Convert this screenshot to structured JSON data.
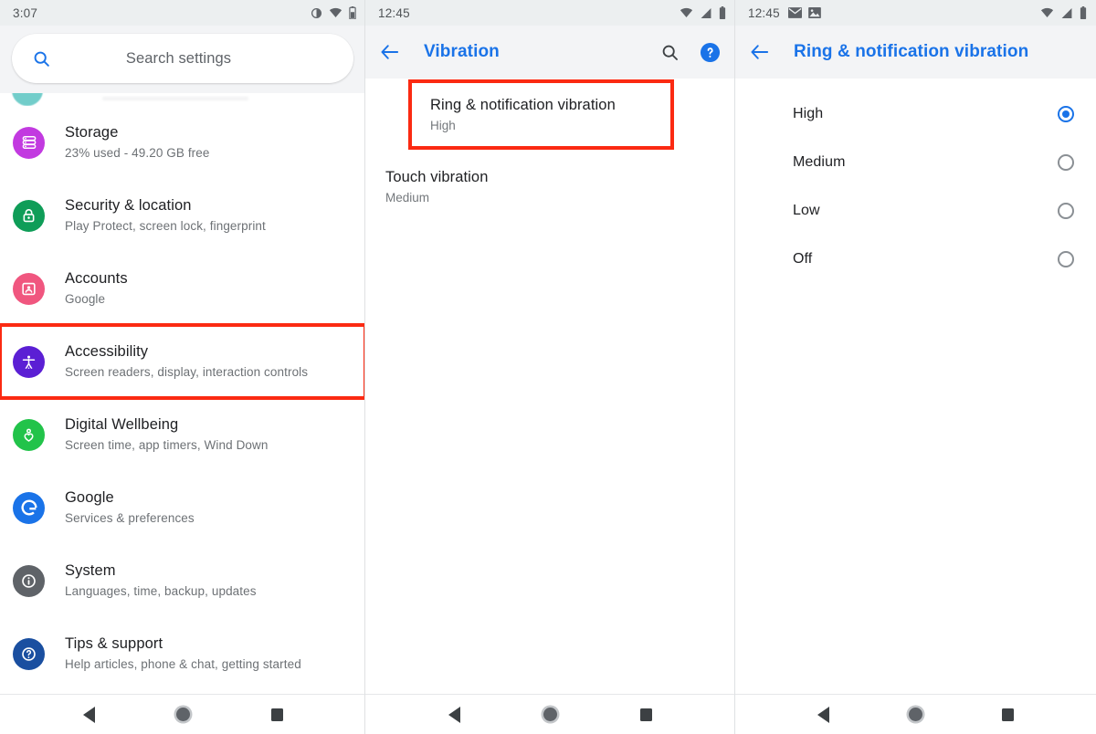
{
  "colors": {
    "accent_blue": "#1a73e8",
    "highlight_red": "#fb2a12",
    "statusbar_bg": "#eceff0",
    "appbar_bg": "#f3f4f6",
    "text_primary": "#202124",
    "text_secondary": "#6d7175"
  },
  "left_panel": {
    "statusbar": {
      "clock": "3:07",
      "icons": [
        "brightness-contrast-icon",
        "wifi-icon",
        "battery-icon"
      ]
    },
    "search": {
      "icon": "search-icon",
      "placeholder": "Search settings",
      "value": ""
    },
    "items": [
      {
        "title": "Storage",
        "subtitle": "23% used - 49.20 GB free",
        "icon": "storage-icon",
        "color": "#c23ae0",
        "highlighted": false
      },
      {
        "title": "Security & location",
        "subtitle": "Play Protect, screen lock, fingerprint",
        "icon": "lock-icon",
        "color": "#0f9d58",
        "highlighted": false
      },
      {
        "title": "Accounts",
        "subtitle": "Google",
        "icon": "account-badge-icon",
        "color": "#f0567f",
        "highlighted": false
      },
      {
        "title": "Accessibility",
        "subtitle": "Screen readers, display, interaction controls",
        "icon": "accessibility-person-icon",
        "color": "#5b1fd4",
        "highlighted": true
      },
      {
        "title": "Digital Wellbeing",
        "subtitle": "Screen time, app timers, Wind Down",
        "icon": "heart-person-icon",
        "color": "#22c34a",
        "highlighted": false
      },
      {
        "title": "Google",
        "subtitle": "Services & preferences",
        "icon": "google-g-icon",
        "color": "#1a73e8",
        "highlighted": false
      },
      {
        "title": "System",
        "subtitle": "Languages, time, backup, updates",
        "icon": "info-circle-icon",
        "color": "#5f6368",
        "highlighted": false
      },
      {
        "title": "Tips & support",
        "subtitle": "Help articles, phone & chat, getting started",
        "icon": "question-circle-icon",
        "color": "#1a4fa0",
        "highlighted": false
      }
    ],
    "navbar": {
      "back": "back-triangle-icon",
      "home": "home-circle-icon",
      "recents": "recents-square-icon"
    }
  },
  "mid_panel": {
    "statusbar": {
      "clock": "12:45",
      "icons": [
        "wifi-icon",
        "signal-icon",
        "battery-icon"
      ]
    },
    "appbar": {
      "back_icon": "back-arrow-icon",
      "title": "Vibration",
      "search_icon": "search-icon",
      "help_icon": "help-circle-icon"
    },
    "items": [
      {
        "title": "Ring & notification vibration",
        "value": "High",
        "highlighted": true
      },
      {
        "title": "Touch vibration",
        "value": "Medium",
        "highlighted": false
      }
    ],
    "navbar": {
      "back": "back-triangle-icon",
      "home": "home-circle-icon",
      "recents": "recents-square-icon"
    }
  },
  "right_panel": {
    "statusbar": {
      "clock": "12:45",
      "icons": [
        "mail-icon",
        "image-icon",
        "wifi-icon",
        "signal-icon",
        "battery-icon"
      ]
    },
    "appbar": {
      "back_icon": "back-arrow-icon",
      "title": "Ring & notification vibration"
    },
    "options": [
      {
        "label": "High",
        "selected": true
      },
      {
        "label": "Medium",
        "selected": false
      },
      {
        "label": "Low",
        "selected": false
      },
      {
        "label": "Off",
        "selected": false
      }
    ],
    "navbar": {
      "back": "back-triangle-icon",
      "home": "home-circle-icon",
      "recents": "recents-square-icon"
    }
  }
}
